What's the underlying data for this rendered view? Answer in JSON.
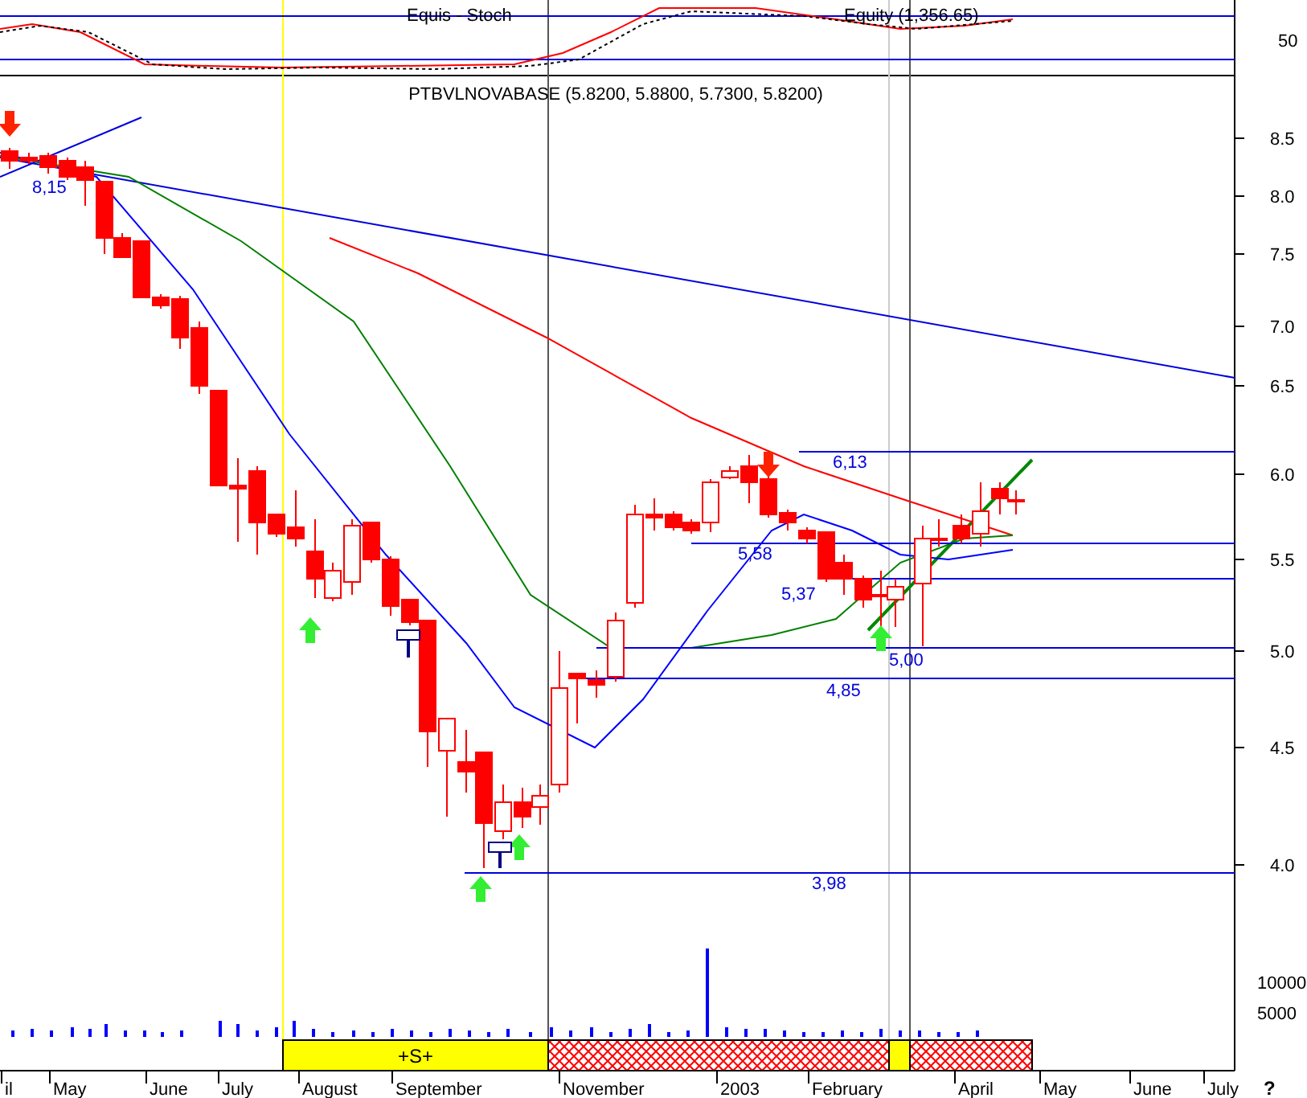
{
  "stochastic_panel": {
    "title_parts": [
      "Equis - Stoch",
      "Equity (1,356.65)"
    ],
    "axis_label": "50"
  },
  "price_panel": {
    "title": "PTBVLNOVABASE (5.8200, 5.8800, 5.7300, 5.8200)",
    "y_axis": [
      "8.5",
      "8.0",
      "7.5",
      "7.0",
      "6.5",
      "6.0",
      "5.5",
      "5.0",
      "4.5",
      "4.0"
    ],
    "level_labels": [
      "8,15",
      "6,13",
      "5,58",
      "5,37",
      "5,00",
      "4,85",
      "3,98"
    ]
  },
  "volume_axis": [
    "10000",
    "5000"
  ],
  "signal_band": [
    {
      "kind": "empty"
    },
    {
      "kind": "signal",
      "label": "+S+"
    },
    {
      "kind": "hatch"
    },
    {
      "kind": "signal"
    },
    {
      "kind": "hatch"
    },
    {
      "kind": "empty"
    }
  ],
  "x_axis": [
    "il",
    "May",
    "June",
    "July",
    "August",
    "September",
    "November",
    "2003",
    "February",
    "April",
    "May",
    "June",
    "July"
  ],
  "help": "?"
}
